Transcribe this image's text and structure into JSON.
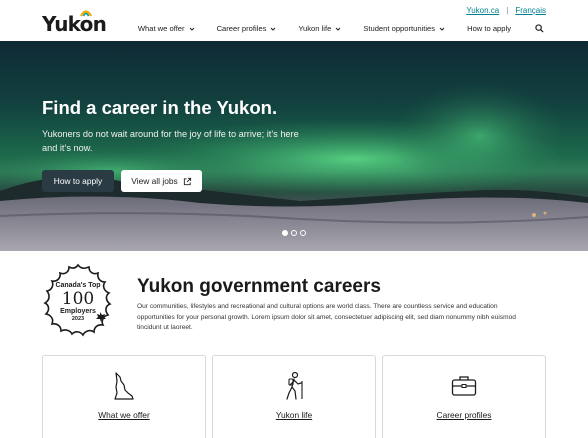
{
  "header": {
    "logo_text": "Yukon",
    "util_links": {
      "site": "Yukon.ca",
      "separator": "|",
      "language": "Français"
    },
    "nav": {
      "items": [
        {
          "label": "What we offer",
          "dropdown": true
        },
        {
          "label": "Career profiles",
          "dropdown": true
        },
        {
          "label": "Yukon life",
          "dropdown": true
        },
        {
          "label": "Student opportunities",
          "dropdown": true
        },
        {
          "label": "How to apply",
          "dropdown": false
        }
      ],
      "search_icon": "search-icon"
    }
  },
  "hero": {
    "title": "Find a career in the Yukon.",
    "subtitle": "Yukoners do not wait around for the joy of life to arrive; it’s here and it’s now.",
    "primary_button": "How to apply",
    "secondary_button": "View all jobs",
    "secondary_button_icon": "external-link-icon",
    "carousel": {
      "slides": 3,
      "active": 1
    }
  },
  "award": {
    "top": "Canada's Top",
    "number": "100",
    "employers": "Employers",
    "year": "2023"
  },
  "intro": {
    "title": "Yukon government careers",
    "body": "Our communities, lifestyles and recreational and cultural options are world class. There are countless service and education opportunities for your personal growth. Lorem ipsum dolor sit amet, consectetuer adipiscing elit, sed diam nonummy nibh euismod tincidunt ut laoreet."
  },
  "cards": [
    {
      "label": "What we offer",
      "icon": "yukon-map-icon"
    },
    {
      "label": "Yukon life",
      "icon": "hiker-icon"
    },
    {
      "label": "Career profiles",
      "icon": "briefcase-icon"
    }
  ],
  "colors": {
    "link": "#00818f",
    "primary_button": "#2a3b44"
  }
}
